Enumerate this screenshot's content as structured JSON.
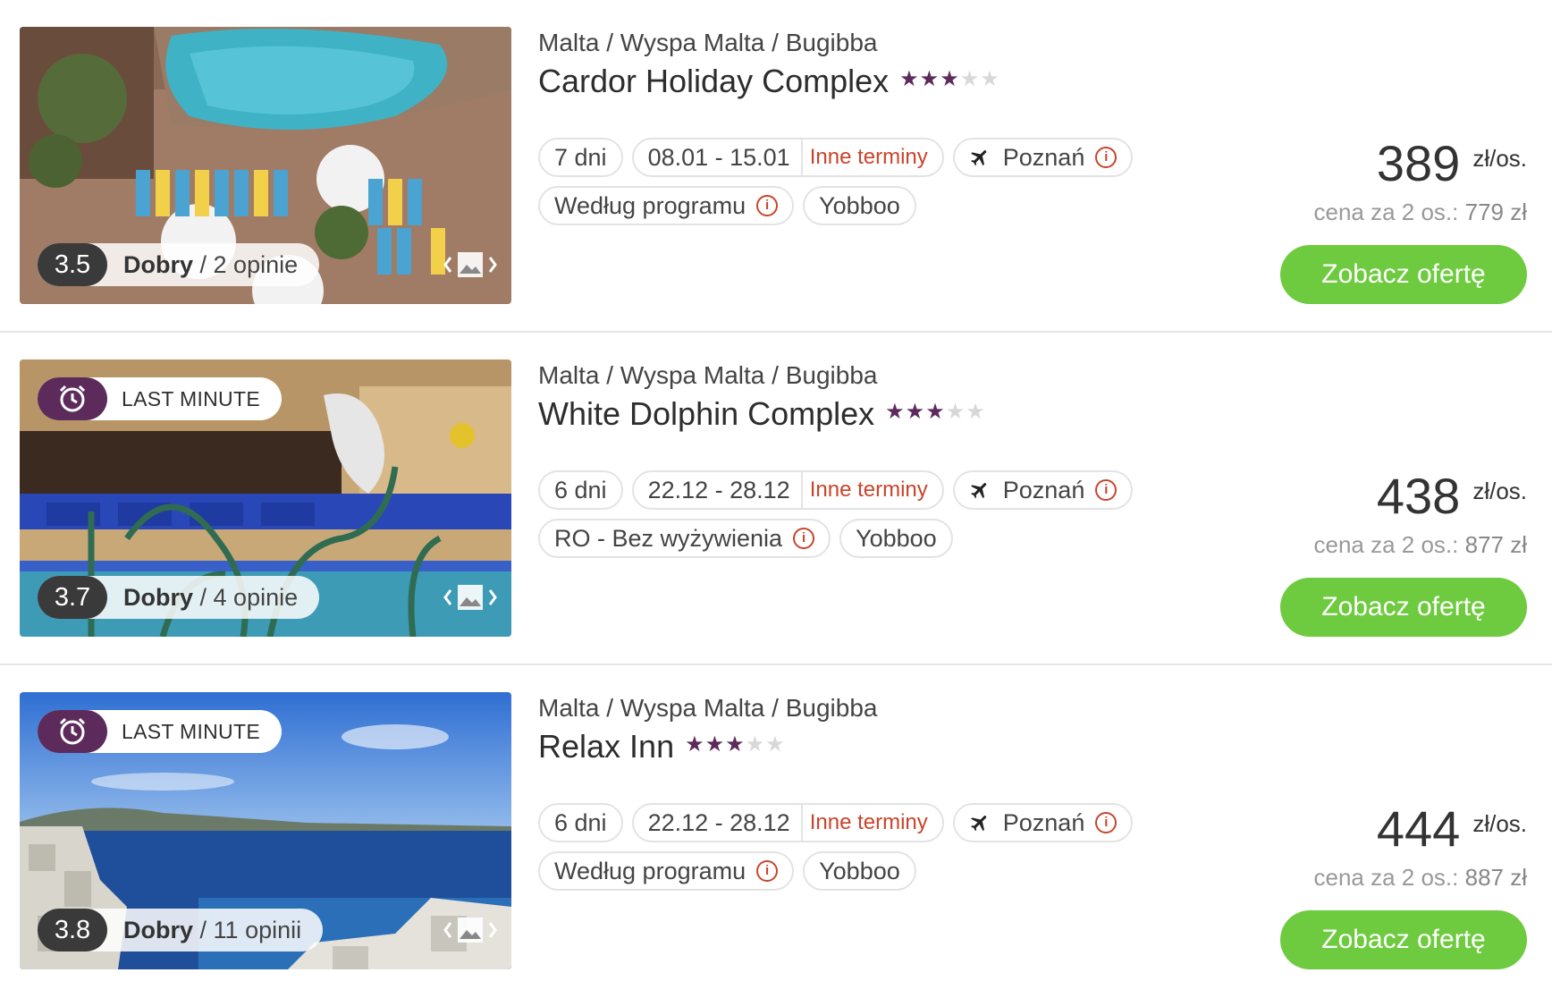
{
  "colors": {
    "accent_purple": "#5c2b5b",
    "cta_green": "#6ecb3f",
    "link_red": "#c9442b"
  },
  "offers": [
    {
      "location": "Malta / Wyspa Malta / Bugibba",
      "name": "Cardor Holiday Complex",
      "stars": 3,
      "last_minute": "",
      "score": "3.5",
      "rating_word": "Dobry",
      "reviews": "/ 2 opinie",
      "duration": "7 dni",
      "dates": "08.01 - 15.01",
      "other_dates": "Inne terminy",
      "departure": "Poznań",
      "board": "Według programu",
      "operator": "Yobboo",
      "price": "389",
      "price_unit": "zł/os.",
      "price_for_two_label": "cena za 2 os.:",
      "price_for_two": "779 zł",
      "cta": "Zobacz ofertę"
    },
    {
      "location": "Malta / Wyspa Malta / Bugibba",
      "name": "White Dolphin Complex",
      "stars": 3,
      "last_minute": "LAST MINUTE",
      "score": "3.7",
      "rating_word": "Dobry",
      "reviews": "/ 4 opinie",
      "duration": "6 dni",
      "dates": "22.12 - 28.12",
      "other_dates": "Inne terminy",
      "departure": "Poznań",
      "board": "RO - Bez wyżywienia",
      "operator": "Yobboo",
      "price": "438",
      "price_unit": "zł/os.",
      "price_for_two_label": "cena za 2 os.:",
      "price_for_two": "877 zł",
      "cta": "Zobacz ofertę"
    },
    {
      "location": "Malta / Wyspa Malta / Bugibba",
      "name": "Relax Inn",
      "stars": 3,
      "last_minute": "LAST MINUTE",
      "score": "3.8",
      "rating_word": "Dobry",
      "reviews": "/ 11 opinii",
      "duration": "6 dni",
      "dates": "22.12 - 28.12",
      "other_dates": "Inne terminy",
      "departure": "Poznań",
      "board": "Według programu",
      "operator": "Yobboo",
      "price": "444",
      "price_unit": "zł/os.",
      "price_for_two_label": "cena za 2 os.:",
      "price_for_two": "887 zł",
      "cta": "Zobacz ofertę"
    }
  ]
}
